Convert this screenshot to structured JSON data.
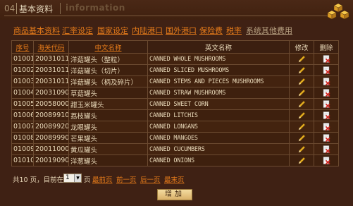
{
  "header": {
    "section_number": "04",
    "title": "基本资料",
    "subtitle": "information"
  },
  "nav": {
    "items": [
      "商品基本资料",
      "汇率设定",
      "国家设定",
      "内陆港口",
      "国外港口",
      "保险费",
      "税率",
      "系统其他费用"
    ]
  },
  "table": {
    "headers": {
      "seq": "序号",
      "hs_code": "海关代码",
      "cn_name": "中文名称",
      "en_name": "英文名称",
      "edit": "修改",
      "delete": "删除"
    },
    "rows": [
      {
        "seq": "01001",
        "hs": "20031011",
        "cn": "洋菇罐头（整粒）",
        "en": "CANNED WHOLE MUSHROOMS"
      },
      {
        "seq": "01002",
        "hs": "20031011",
        "cn": "洋菇罐头（切片）",
        "en": "CANNED SLICED MUSHROOMS"
      },
      {
        "seq": "01003",
        "hs": "20031011",
        "cn": "洋菇罐头（柄及碎片）",
        "en": "CANNED STEMS AND PIECES MUSHROOMS"
      },
      {
        "seq": "01004",
        "hs": "20031090",
        "cn": "草菇罐头",
        "en": "CANNED STRAW MUSHROOMS"
      },
      {
        "seq": "01005",
        "hs": "20058000",
        "cn": "甜玉米罐头",
        "en": "CANNED SWEET CORN"
      },
      {
        "seq": "01006",
        "hs": "20089910",
        "cn": "荔枝罐头",
        "en": "CANNED LITCHIS"
      },
      {
        "seq": "01007",
        "hs": "20089920",
        "cn": "龙眼罐头",
        "en": "CANNED LONGANS"
      },
      {
        "seq": "01008",
        "hs": "20089990",
        "cn": "芒果罐头",
        "en": "CANNED MANGOES"
      },
      {
        "seq": "01009",
        "hs": "20011000",
        "cn": "黄瓜罐头",
        "en": "CANNED CUCUMBERS"
      },
      {
        "seq": "01010",
        "hs": "20019090",
        "cn": "洋葱罐头",
        "en": "CANNED ONIONS"
      }
    ]
  },
  "pager": {
    "total_text": "共10 页，目前在第",
    "current_page": "1",
    "page_suffix": "页",
    "first": "最前页",
    "prev": "前一页",
    "next": "后一页",
    "last": "最末页"
  },
  "add_button": "增加",
  "colors": {
    "background": "#3f2114",
    "link": "#e57b1a",
    "text": "#e8d8b8",
    "border": "#6b4a30"
  },
  "icons": {
    "edit": "pencil-icon",
    "delete": "delete-doc-icon",
    "logo": "cubes-icon"
  }
}
